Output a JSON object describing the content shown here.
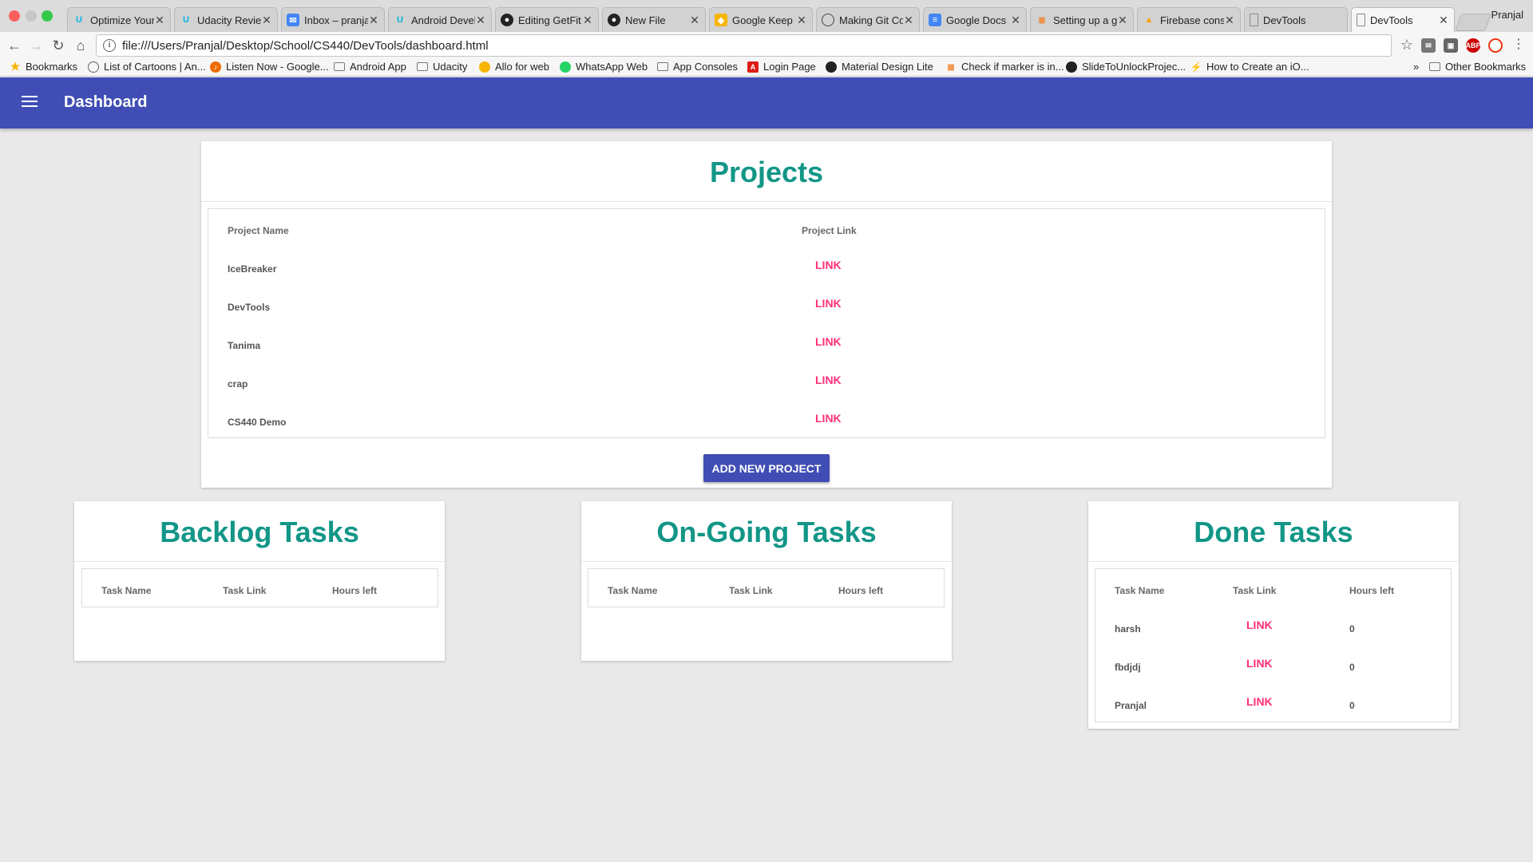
{
  "browser": {
    "tabs": [
      {
        "title": "Optimize Your",
        "icon": "udacity-icon",
        "color": "#02b3e4"
      },
      {
        "title": "Udacity Review",
        "icon": "udacity-icon",
        "color": "#02b3e4"
      },
      {
        "title": "Inbox – pranjal",
        "icon": "inbox-icon",
        "color": "#4285f4"
      },
      {
        "title": "Android Devel",
        "icon": "udacity-icon",
        "color": "#02b3e4"
      },
      {
        "title": "Editing GetFit",
        "icon": "github-icon",
        "color": "#222222"
      },
      {
        "title": "New File",
        "icon": "github-icon",
        "color": "#222222"
      },
      {
        "title": "Google Keep",
        "icon": "keep-icon",
        "color": "#f7b500"
      },
      {
        "title": "Making Git Co",
        "icon": "git-icon",
        "color": "#444444"
      },
      {
        "title": "Google Docs",
        "icon": "docs-icon",
        "color": "#4285f4"
      },
      {
        "title": "Setting up a g",
        "icon": "stackoverflow-icon",
        "color": "#f48024"
      },
      {
        "title": "Firebase cons",
        "icon": "firebase-icon",
        "color": "#ffa000"
      },
      {
        "title": "DevTools",
        "icon": "page-icon",
        "color": "#888888"
      },
      {
        "title": "DevTools",
        "icon": "page-icon",
        "color": "#888888"
      }
    ],
    "profile": "Pranjal",
    "url": "file:///Users/Pranjal/Desktop/School/CS440/DevTools/dashboard.html",
    "bookmarks": [
      {
        "label": "Bookmarks",
        "icon": "star-icon"
      },
      {
        "label": "List of Cartoons | An...",
        "icon": "globe-icon"
      },
      {
        "label": "Listen Now - Google...",
        "icon": "music-icon"
      },
      {
        "label": "Android App",
        "icon": "folder-icon"
      },
      {
        "label": "Udacity",
        "icon": "folder-icon"
      },
      {
        "label": "Allo for web",
        "icon": "allo-icon"
      },
      {
        "label": "WhatsApp Web",
        "icon": "whatsapp-icon"
      },
      {
        "label": "App Consoles",
        "icon": "folder-icon"
      },
      {
        "label": "Login Page",
        "icon": "angular-icon"
      },
      {
        "label": "Material Design Lite",
        "icon": "github-icon"
      },
      {
        "label": "Check if marker is in...",
        "icon": "stackoverflow-icon"
      },
      {
        "label": "SlideToUnlockProjec...",
        "icon": "github-icon"
      },
      {
        "label": "How to Create an iO...",
        "icon": "swift-icon"
      },
      {
        "label": "Other Bookmarks",
        "icon": "folder-icon"
      }
    ],
    "overflow": "»"
  },
  "app": {
    "title": "Dashboard",
    "projects": {
      "title": "Projects",
      "col_name": "Project Name",
      "col_link": "Project Link",
      "rows": [
        {
          "name": "IceBreaker",
          "link": "LINK"
        },
        {
          "name": "DevTools",
          "link": "LINK"
        },
        {
          "name": "Tanima",
          "link": "LINK"
        },
        {
          "name": "crap",
          "link": "LINK"
        },
        {
          "name": "CS440 Demo",
          "link": "LINK"
        }
      ],
      "add_button": "ADD NEW PROJECT"
    },
    "backlog": {
      "title": "Backlog Tasks",
      "cols": [
        "Task Name",
        "Task Link",
        "Hours left"
      ]
    },
    "ongoing": {
      "title": "On-Going Tasks",
      "cols": [
        "Task Name",
        "Task Link",
        "Hours left"
      ]
    },
    "done": {
      "title": "Done Tasks",
      "cols": [
        "Task Name",
        "Task Link",
        "Hours left"
      ],
      "rows": [
        {
          "name": "harsh",
          "link": "LINK",
          "hours": "0"
        },
        {
          "name": "fbdjdj",
          "link": "LINK",
          "hours": "0"
        },
        {
          "name": "Pranjal",
          "link": "LINK",
          "hours": "0"
        }
      ]
    }
  },
  "colors": {
    "appbar": "#3f4db5",
    "title": "#129687",
    "link": "#ff2f7a"
  }
}
